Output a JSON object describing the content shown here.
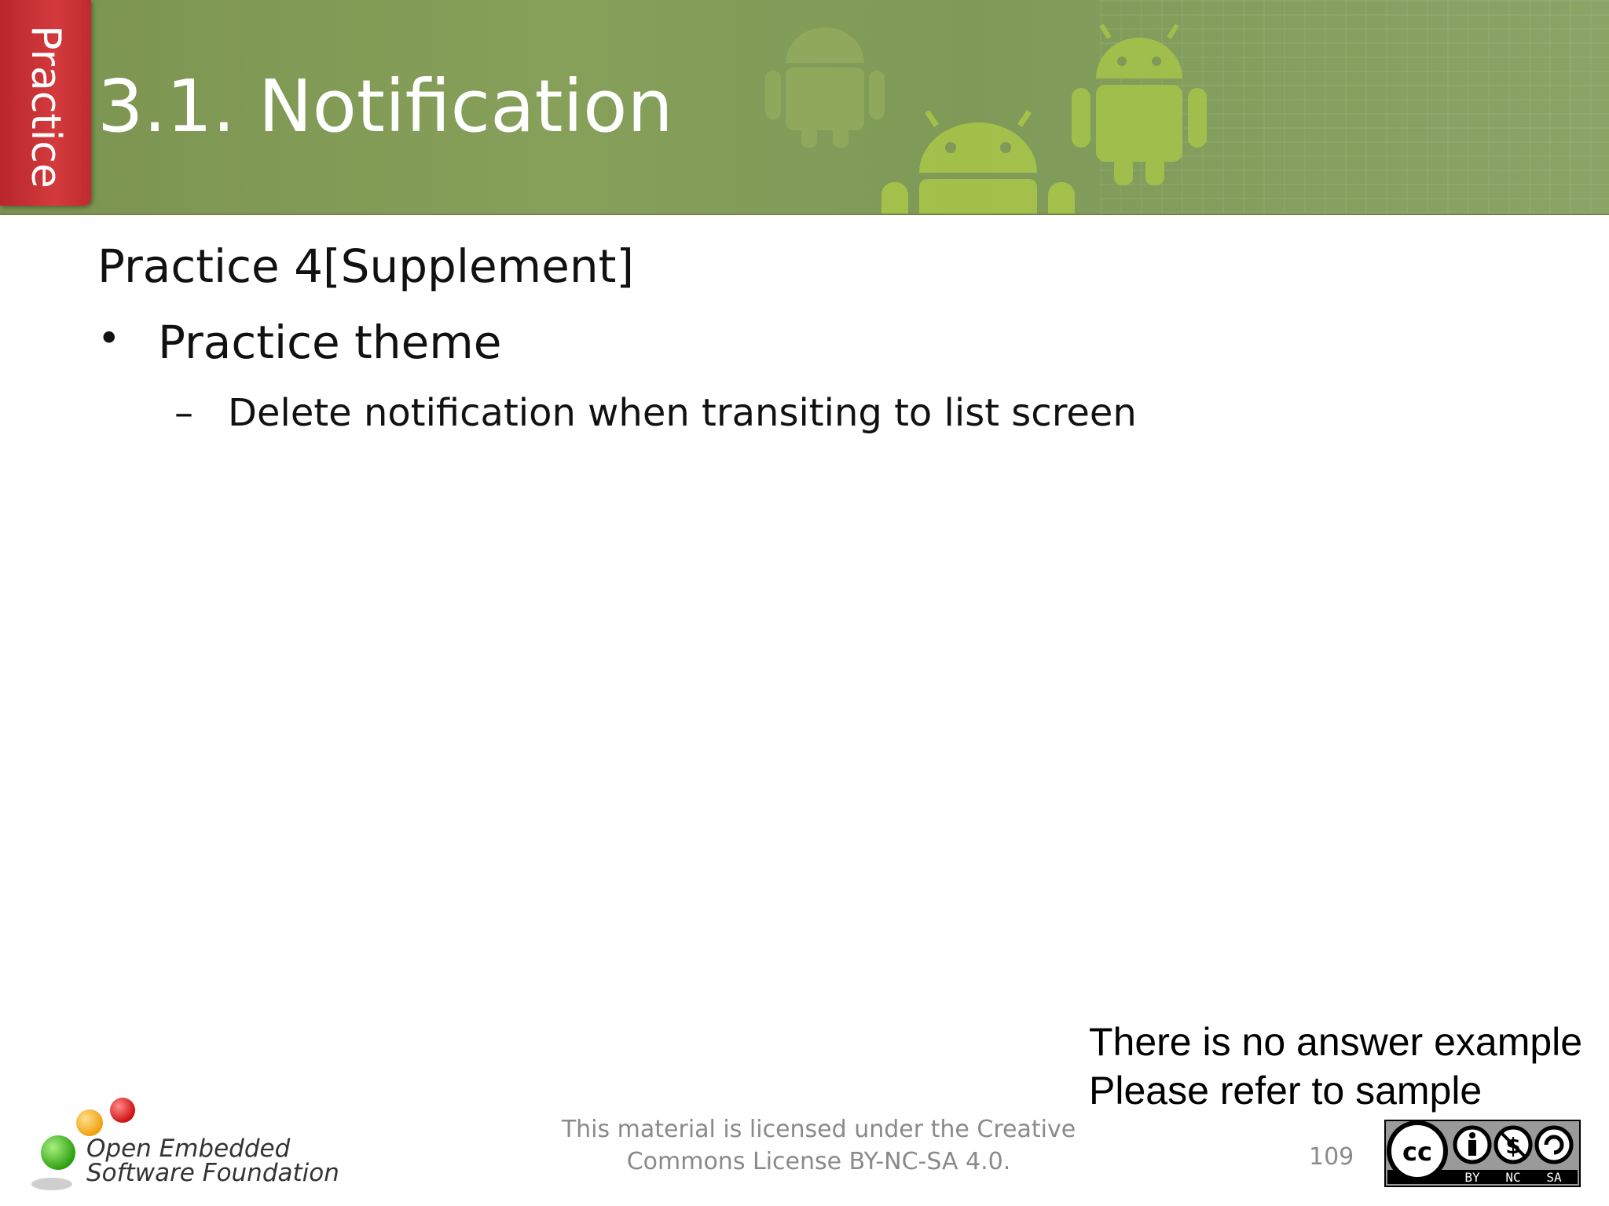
{
  "header": {
    "section_tab": "Practice",
    "title": "3.1. Notification"
  },
  "content": {
    "heading": "Practice 4[Supplement]",
    "bullet": "Practice theme",
    "sub_bullet": "Delete notification when transiting to list screen"
  },
  "note": {
    "line1": "There is no answer example",
    "line2": "Please refer to sample"
  },
  "footer": {
    "license_line1": "This material is licensed under the Creative",
    "license_line2": "Commons License BY-NC-SA 4.0.",
    "page_number": "109",
    "logo_line1": "Open Embedded",
    "logo_line2": "Software Foundation",
    "cc_labels": [
      "BY",
      "NC",
      "SA"
    ]
  },
  "colors": {
    "header_green": "#7f9a58",
    "tab_red": "#c92f33",
    "android_green": "#a4c24a"
  },
  "icons": [
    "android-icon",
    "cc-license-badge",
    "foundation-logo"
  ]
}
